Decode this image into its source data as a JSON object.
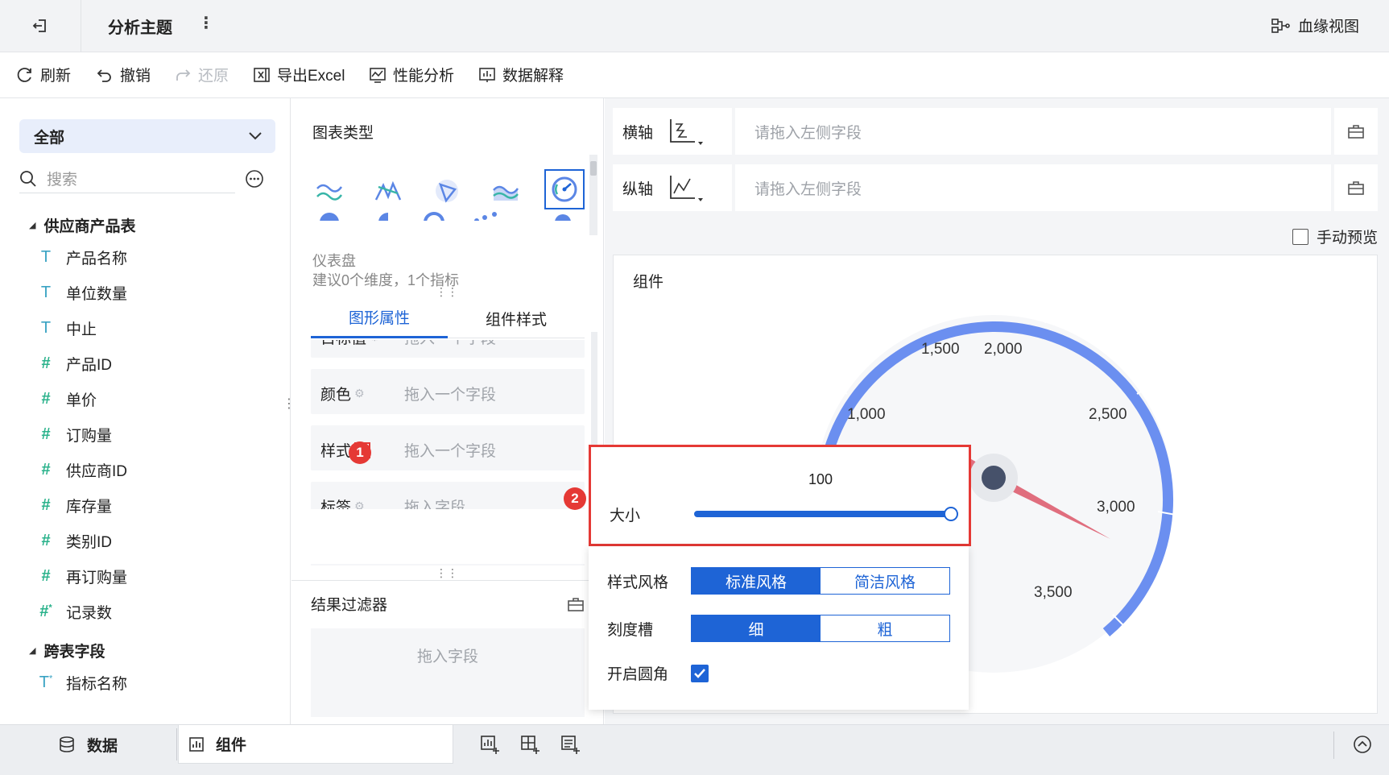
{
  "topbar": {
    "title": "分析主题",
    "more": "⋮",
    "lineage": "血缘视图"
  },
  "toolbar": {
    "refresh": "刷新",
    "undo": "撤销",
    "redo": "还原",
    "export": "导出Excel",
    "perf": "性能分析",
    "explain": "数据解释"
  },
  "left": {
    "select_value": "全部",
    "search_placeholder": "搜索",
    "groups": [
      {
        "name": "供应商产品表",
        "fields": [
          {
            "type": "T",
            "label": "产品名称"
          },
          {
            "type": "T",
            "label": "单位数量"
          },
          {
            "type": "T",
            "label": "中止"
          },
          {
            "type": "#",
            "label": "产品ID"
          },
          {
            "type": "#",
            "label": "单价"
          },
          {
            "type": "#",
            "label": "订购量"
          },
          {
            "type": "#",
            "label": "供应商ID"
          },
          {
            "type": "#",
            "label": "库存量"
          },
          {
            "type": "#",
            "label": "类别ID"
          },
          {
            "type": "#",
            "label": "再订购量"
          },
          {
            "type": "#*",
            "label": "记录数"
          }
        ]
      },
      {
        "name": "跨表字段",
        "fields": [
          {
            "type": "T*",
            "label": "指标名称"
          }
        ]
      }
    ]
  },
  "mid": {
    "chart_type_title": "图表类型",
    "chart_name": "仪表盘",
    "chart_hint": "建议0个维度，1个指标",
    "tabs": [
      "图形属性",
      "组件样式"
    ],
    "props": [
      {
        "label": "目标值",
        "drop": "拖入一个字段"
      },
      {
        "label": "颜色",
        "drop": "拖入一个字段"
      },
      {
        "label": "样式",
        "drop": "拖入一个字段"
      },
      {
        "label": "标签",
        "drop": "拖入字段"
      }
    ],
    "badge1": "1",
    "filter_title": "结果过滤器",
    "filter_drop": "拖入字段"
  },
  "right": {
    "x_axis": "横轴",
    "y_axis": "纵轴",
    "axis_placeholder": "请拖入左侧字段",
    "manual_preview": "手动预览",
    "canvas_title": "组件",
    "gauge_labels": [
      "1,000",
      "1,500",
      "2,000",
      "2,500",
      "3,000",
      "3,500"
    ]
  },
  "popup": {
    "badge2": "2",
    "size_value": "100",
    "size_label": "大小",
    "style_label": "样式风格",
    "style_options": [
      "标准风格",
      "简洁风格"
    ],
    "tick_label": "刻度槽",
    "tick_options": [
      "细",
      "粗"
    ],
    "round_label": "开启圆角"
  },
  "bottom": {
    "tab_data": "数据",
    "tab_component": "组件"
  },
  "colors": {
    "accent": "#1e64d6",
    "gauge": "#6b8ff0",
    "highlight": "#e53935"
  }
}
